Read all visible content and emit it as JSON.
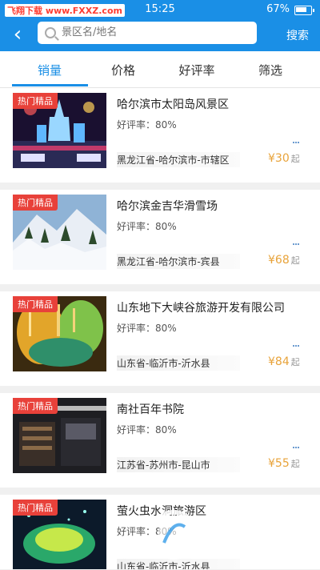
{
  "status": {
    "watermark": "飞翔下载 www.FXXZ.com",
    "time": "15:25",
    "battery": "67%"
  },
  "search": {
    "placeholder": "景区名/地名",
    "button": "搜索"
  },
  "tabs": [
    "销量",
    "价格",
    "好评率",
    "筛选"
  ],
  "items": [
    {
      "badge": "热门精品",
      "title": "哈尔滨市太阳岛风景区",
      "rating": "好评率：80%",
      "location": "黑龙江省-哈尔滨市-市辖区",
      "price": "¥30",
      "price_suffix": "起"
    },
    {
      "badge": "热门精品",
      "title": "哈尔滨金吉华滑雪场",
      "rating": "好评率：80%",
      "location": "黑龙江省-哈尔滨市-宾县",
      "price": "¥68",
      "price_suffix": "起"
    },
    {
      "badge": "热门精品",
      "title": "山东地下大峡谷旅游开发有限公司",
      "rating": "好评率：80%",
      "location": "山东省-临沂市-沂水县",
      "price": "¥84",
      "price_suffix": "起"
    },
    {
      "badge": "热门精品",
      "title": "南社百年书院",
      "rating": "好评率：80%",
      "location": "江苏省-苏州市-昆山市",
      "price": "¥55",
      "price_suffix": "起"
    },
    {
      "badge": "热门精品",
      "title": "萤火虫水洞旅游区",
      "rating": "好评率：80%",
      "location": "山东省-临沂市-沂水县",
      "price": "",
      "price_suffix": ""
    }
  ],
  "watermark_logo": {
    "text": "飞翔下载",
    "url": "www.fxxz.com"
  },
  "colors": {
    "primary": "#1a8fe6",
    "badge": "#e8413a",
    "price": "#e8a33a"
  }
}
